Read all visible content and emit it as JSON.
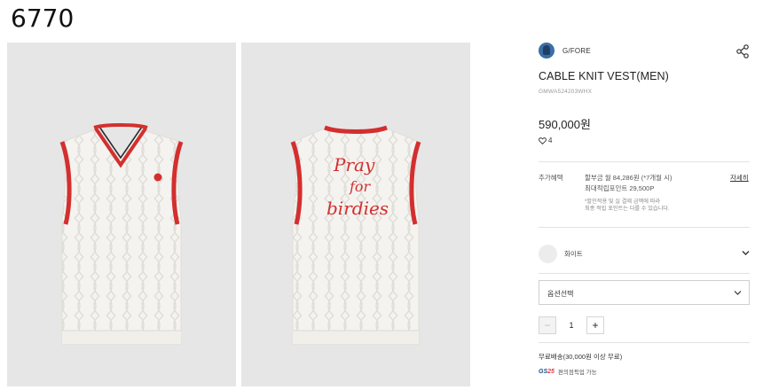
{
  "page": {
    "code": "6770"
  },
  "gallery": {
    "front_alt": "front view",
    "back_alt": "back view",
    "embroidery": [
      "Pray",
      "for",
      "birdies"
    ]
  },
  "product": {
    "brand": "G/FORE",
    "title": "CABLE KNIT VEST(MEN)",
    "code": "GMWA524203WHX",
    "price": "590,000원",
    "likes": "4"
  },
  "benefits": {
    "label": "추가혜택",
    "installment": "할부금 월 84,286원 (*7개월 시)",
    "points": "최대적립포인트 29,500P",
    "note_line1": "*할인적용 및 실 결제 금액에 따라",
    "note_line2": "최종 적립 포인트는 다를 수 있습니다.",
    "detail_link": "자세히"
  },
  "color": {
    "selected": "화이트"
  },
  "option": {
    "placeholder": "옵션선택"
  },
  "quantity": {
    "minus": "−",
    "value": "1",
    "plus": "+"
  },
  "shipping": {
    "text": "무료배송(30,000원 이상 무료)",
    "gs_logo_left": "GS",
    "gs_logo_right": "25",
    "gs_text": "편의점픽업 가능"
  },
  "colors": {
    "accent_red": "#d32f2f",
    "photo_bg": "#e6e6e6",
    "knit": "#f4f3ef"
  },
  "icons": {
    "share": "share-icon",
    "heart": "heart-icon",
    "chevron": "chevron-down-icon"
  }
}
